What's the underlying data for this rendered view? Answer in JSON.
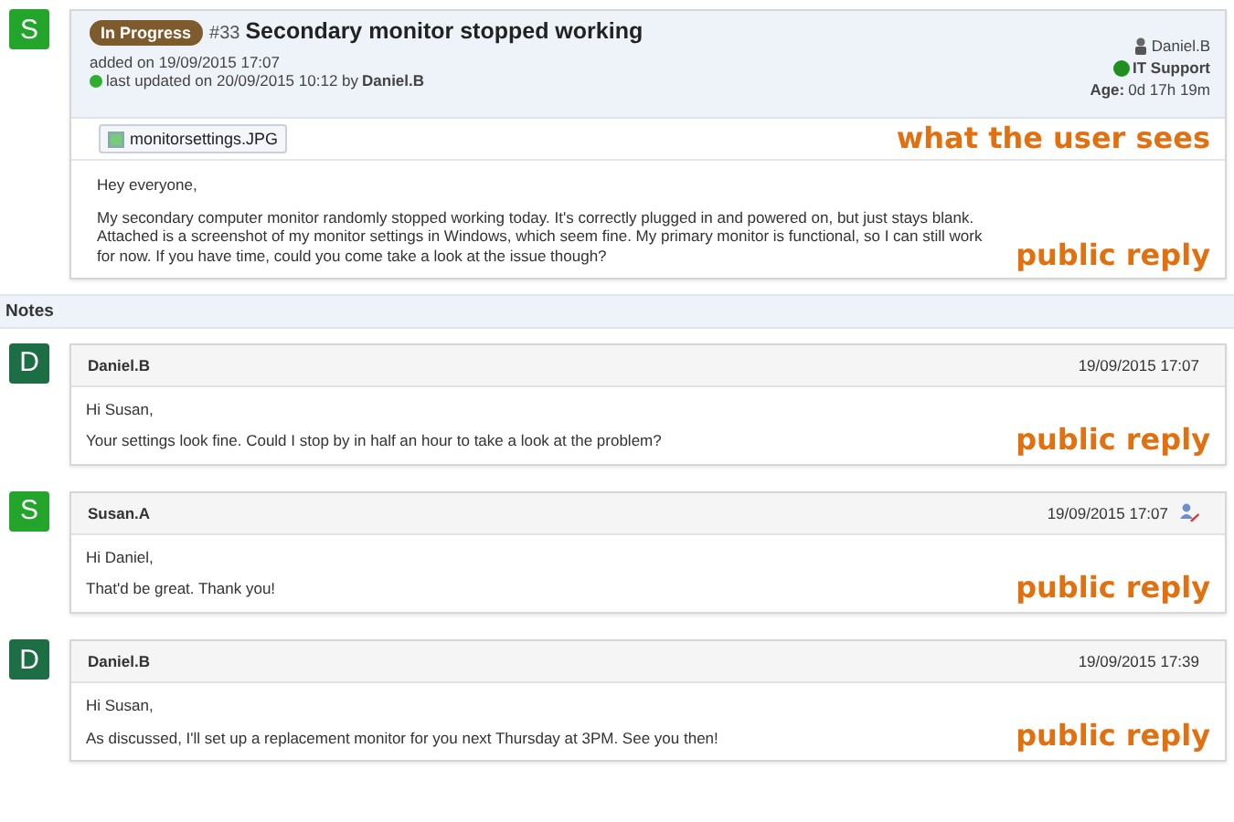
{
  "ticket": {
    "avatar": {
      "letter": "S",
      "color": "#22a52a"
    },
    "status": "In Progress",
    "number": "#33",
    "title": "Secondary monitor stopped working",
    "added": "added on 19/09/2015 17:07",
    "updated": "last updated on 20/09/2015 10:12 by",
    "updated_by": "Daniel.B",
    "assignee": "Daniel.B",
    "team": "IT Support",
    "age_label": "Age:",
    "age": "0d 17h 19m",
    "attachment": "monitorsettings.JPG",
    "annotation": "what the user sees",
    "paragraphs": [
      "Hey everyone,",
      "My secondary computer monitor randomly stopped working today. It's correctly plugged in and powered on, but just stays blank. Attached is a screenshot of my monitor settings in Windows, which seem fine. My primary monitor is functional, so I can still work for now. If you have time, could you come take a look at the issue though?"
    ],
    "tag": "public reply"
  },
  "notes_heading": "Notes",
  "notes": [
    {
      "avatar": {
        "letter": "D",
        "color": "#1d6e45"
      },
      "author": "Daniel.B",
      "time": "19/09/2015 17:07",
      "edit_icon": false,
      "paragraphs": [
        "Hi Susan,",
        "Your settings look fine. Could I stop by in half an hour to take a look at the problem?"
      ],
      "tag": "public reply"
    },
    {
      "avatar": {
        "letter": "S",
        "color": "#22a52a"
      },
      "author": "Susan.A",
      "time": "19/09/2015 17:07",
      "edit_icon": true,
      "paragraphs": [
        "Hi Daniel,",
        "That'd be great. Thank you!"
      ],
      "tag": "public reply"
    },
    {
      "avatar": {
        "letter": "D",
        "color": "#1d6e45"
      },
      "author": "Daniel.B",
      "time": "19/09/2015 17:39",
      "edit_icon": false,
      "paragraphs": [
        "Hi Susan,",
        "As discussed, I'll set up a replacement monitor for you next Thursday at 3PM. See you then!"
      ],
      "tag": "public reply"
    }
  ]
}
